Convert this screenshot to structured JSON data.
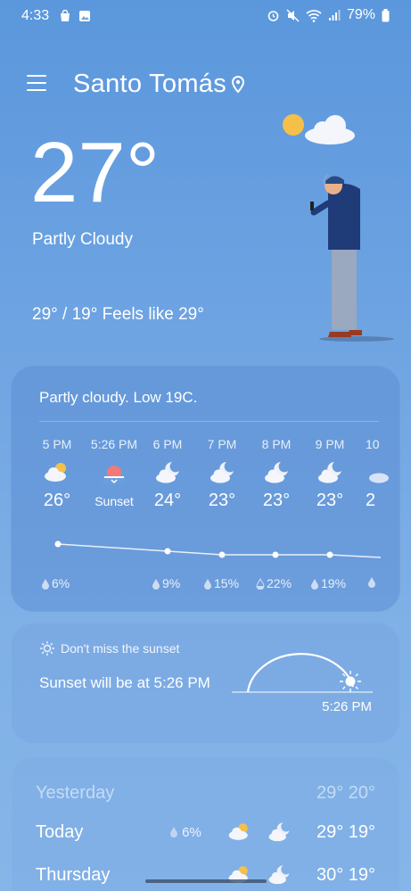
{
  "status_bar": {
    "time": "4:33",
    "battery": "79%"
  },
  "location": {
    "name": "Santo Tomás"
  },
  "current": {
    "temperature": "27°",
    "condition": "Partly Cloudy",
    "hi_lo_feels": "29° / 19° Feels like 29°"
  },
  "hourly": {
    "summary": "Partly cloudy. Low 19C.",
    "hours": [
      {
        "time": "5 PM",
        "temp": "26°",
        "icon": "partly-cloudy-day-icon",
        "precip": "6%"
      },
      {
        "time": "5:26 PM",
        "temp": "Sunset",
        "icon": "sunset-icon",
        "precip": ""
      },
      {
        "time": "6 PM",
        "temp": "24°",
        "icon": "partly-cloudy-night-icon",
        "precip": "9%"
      },
      {
        "time": "7 PM",
        "temp": "23°",
        "icon": "partly-cloudy-night-icon",
        "precip": "15%"
      },
      {
        "time": "8 PM",
        "temp": "23°",
        "icon": "partly-cloudy-night-icon",
        "precip": "22%"
      },
      {
        "time": "9 PM",
        "temp": "23°",
        "icon": "partly-cloudy-night-icon",
        "precip": "19%"
      },
      {
        "time": "10",
        "temp": "2",
        "icon": "partly-cloudy-night-icon",
        "precip": ""
      }
    ]
  },
  "sunset_card": {
    "tip": "Don't miss the sunset",
    "text": "Sunset will be at 5:26 PM",
    "time": "5:26 PM"
  },
  "daily": [
    {
      "day": "Yesterday",
      "precip": "",
      "temps": "29° 20°",
      "dim": true
    },
    {
      "day": "Today",
      "precip": "6%",
      "temps": "29° 19°",
      "dim": false
    },
    {
      "day": "Thursday",
      "precip": "",
      "temps": "30° 19°",
      "dim": false
    }
  ],
  "colors": {
    "background_top": "#5b97dc",
    "background_bottom": "#86b6e8",
    "sun": "#f5c04a",
    "sunset_glow": "#f07a7a"
  }
}
